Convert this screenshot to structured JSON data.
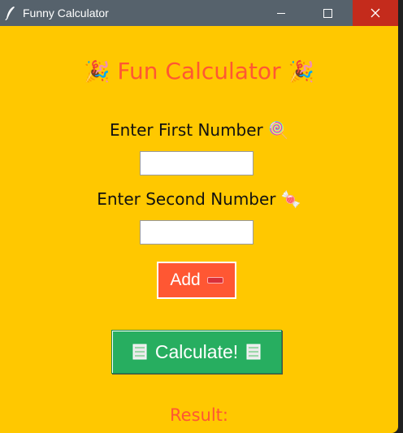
{
  "window": {
    "title": "Funny Calculator",
    "background_color": "#ffc800",
    "titlebar_color": "#56626c",
    "close_hover_color": "#c42b1c"
  },
  "heading": {
    "text": "Fun Calculator",
    "left_icon": "party-popper-icon",
    "right_icon": "party-popper-icon",
    "color": "#ff5733"
  },
  "first_number": {
    "label": "Enter First Number",
    "icon": "lollipop-icon",
    "value": ""
  },
  "second_number": {
    "label": "Enter Second Number",
    "icon": "candy-icon",
    "value": ""
  },
  "operation": {
    "selected": "Add",
    "icon": "minus-icon",
    "color": "#ff5733"
  },
  "calculate_button": {
    "label": "Calculate!",
    "icon": "abacus-icon",
    "color": "#27ae60"
  },
  "result": {
    "label": "Result:"
  }
}
